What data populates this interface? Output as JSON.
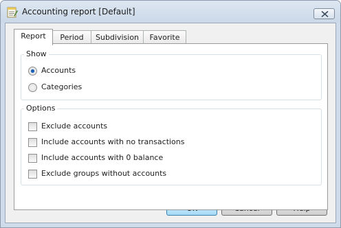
{
  "window": {
    "title": "Accounting report [Default]"
  },
  "tabs": [
    {
      "label": "Report",
      "active": true
    },
    {
      "label": "Period",
      "active": false
    },
    {
      "label": "Subdivision",
      "active": false
    },
    {
      "label": "Favorite",
      "active": false
    }
  ],
  "show_group": {
    "title": "Show",
    "options": [
      {
        "label": "Accounts",
        "selected": true
      },
      {
        "label": "Categories",
        "selected": false
      }
    ]
  },
  "options_group": {
    "title": "Options",
    "checkboxes": [
      {
        "label": "Exclude accounts",
        "checked": false
      },
      {
        "label": "Include accounts with no transactions",
        "checked": false
      },
      {
        "label": "Include accounts with 0 balance",
        "checked": false
      },
      {
        "label": "Exclude groups without accounts",
        "checked": false
      }
    ]
  },
  "buttons": {
    "ok": "OK",
    "cancel": "Cancel",
    "help": "Help"
  },
  "icons": {
    "app": "report-notepad-icon",
    "close": "close-icon"
  }
}
